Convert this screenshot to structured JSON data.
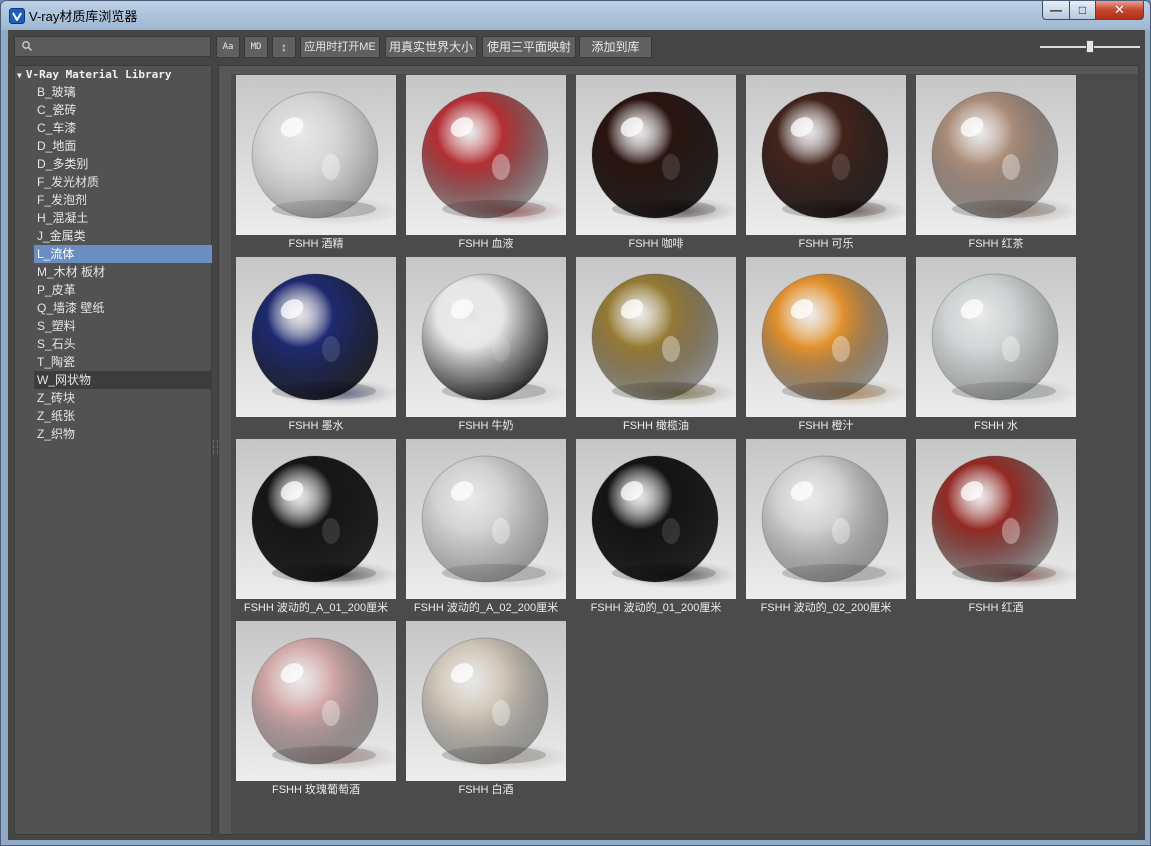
{
  "window": {
    "title": "V-ray材质库浏览器",
    "min_glyph": "—",
    "max_glyph": "□",
    "close_glyph": "✕"
  },
  "toolbar": {
    "search_placeholder": "",
    "btn_font": "Aa",
    "btn_md": "MD",
    "btn_sort": "↕",
    "btn_apply_open": "应用时打开ME",
    "btn_real_size": "用真实世界大小",
    "btn_triplanar": "使用三平面映射",
    "btn_add_library": "添加到库",
    "zoom_level": 0.5
  },
  "tree": {
    "root": "V-Ray Material Library",
    "items": [
      "B_玻璃",
      "C_瓷砖",
      "C_车漆",
      "D_地面",
      "D_多类别",
      "F_发光材质",
      "F_发泡剂",
      "H_混凝土",
      "J_金属类",
      "L_流体",
      "M_木材 板材",
      "P_皮革",
      "Q_墙漆 壁纸",
      "S_塑料",
      "S_石头",
      "T_陶瓷",
      "W_网状物",
      "Z_砖块",
      "Z_纸张",
      "Z_织物"
    ],
    "selected": "L_流体",
    "highlighted": "W_网状物"
  },
  "materials": [
    {
      "label": "FSHH 酒精",
      "color": "#e8e8e8",
      "opacity": 0.25
    },
    {
      "label": "FSHH 血液",
      "color": "#b01c22",
      "opacity": 0.9
    },
    {
      "label": "FSHH 咖啡",
      "color": "#2a1410",
      "opacity": 1
    },
    {
      "label": "FSHH 可乐",
      "color": "#3b1a12",
      "opacity": 0.95
    },
    {
      "label": "FSHH 红茶",
      "color": "#a07a62",
      "opacity": 0.8
    },
    {
      "label": "FSHH 墨水",
      "color": "#1e2a70",
      "opacity": 1
    },
    {
      "label": "FSHH 牛奶",
      "color": "#e6e6e6",
      "opacity": 1
    },
    {
      "label": "FSHH 橄榄油",
      "color": "#8a6a18",
      "opacity": 0.85
    },
    {
      "label": "FSHH 橙汁",
      "color": "#e4891a",
      "opacity": 0.9
    },
    {
      "label": "FSHH 水",
      "color": "#c9d6d6",
      "opacity": 0.4
    },
    {
      "label": "FSHH 波动的_A_01_200厘米",
      "color": "#161616",
      "opacity": 1
    },
    {
      "label": "FSHH 波动的_A_02_200厘米",
      "color": "#d4d4d4",
      "opacity": 0.45
    },
    {
      "label": "FSHH 波动的_01_200厘米",
      "color": "#141414",
      "opacity": 1
    },
    {
      "label": "FSHH 波动的_02_200厘米",
      "color": "#cfcfcf",
      "opacity": 0.6
    },
    {
      "label": "FSHH 红酒",
      "color": "#8e1a14",
      "opacity": 0.92
    },
    {
      "label": "FSHH 玫瑰葡萄酒",
      "color": "#d49a9a",
      "opacity": 0.75
    },
    {
      "label": "FSHH 白酒",
      "color": "#cfc0a8",
      "opacity": 0.6
    }
  ]
}
